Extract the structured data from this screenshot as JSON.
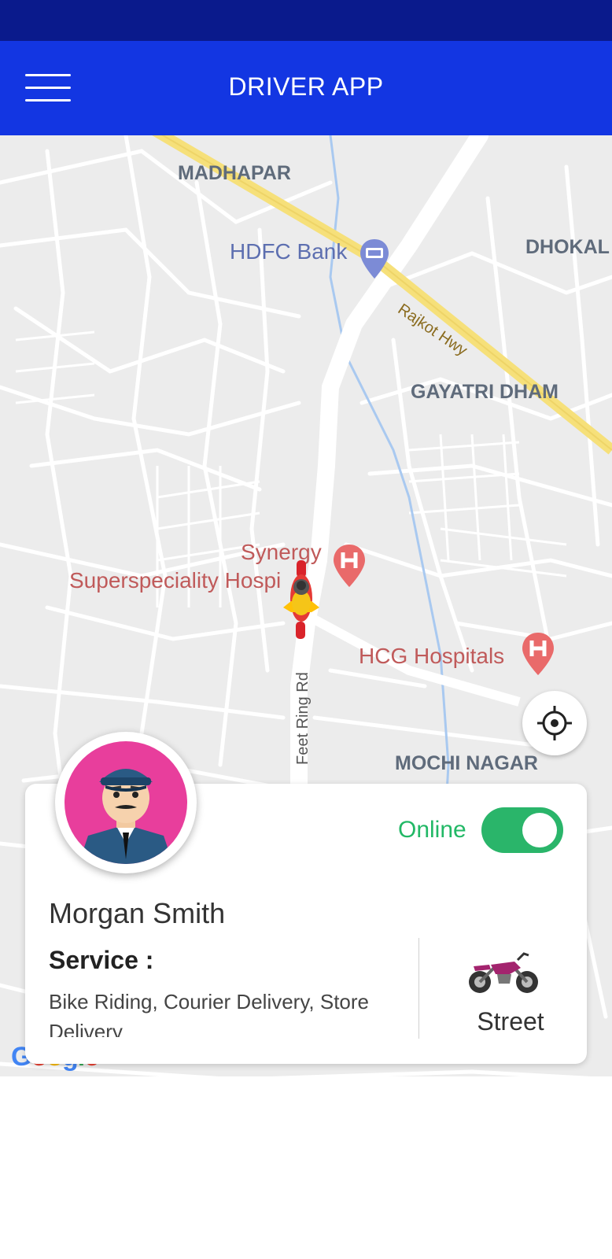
{
  "header": {
    "title": "DRIVER APP",
    "menu_icon": "hamburger-menu-icon"
  },
  "map": {
    "areas": [
      "MADHAPAR",
      "DHOKAL",
      "GAYATRI DHAM",
      "MOCHI NAGAR"
    ],
    "pois": {
      "bank": "HDFC Bank",
      "hospital_1_line1": "Synergy",
      "hospital_1_line2": "Superspeciality Hospi",
      "hospital_2": "HCG Hospitals"
    },
    "roads": {
      "highway": "Rajkot Hwy",
      "ring_road": "Feet Ring Rd"
    },
    "attribution": "Google",
    "locate_icon": "my-location-icon",
    "marker_icon": "bike-rider-marker-icon",
    "colors": {
      "highway": "#f6e07a",
      "road": "#ffffff",
      "background": "#ececec",
      "water": "#a9c9f0"
    }
  },
  "driver": {
    "name": "Morgan Smith",
    "status_label": "Online",
    "status_on": true,
    "service_heading": "Service :",
    "services": "Bike Riding, Courier Delivery, Store Delivery",
    "vehicle_type": "Street",
    "avatar_icon": "driver-avatar-icon",
    "vehicle_icon": "motorbike-icon"
  },
  "colors": {
    "status_bar": "#0a1a8c",
    "app_bar": "#1336e2",
    "online_green": "#22b866"
  }
}
